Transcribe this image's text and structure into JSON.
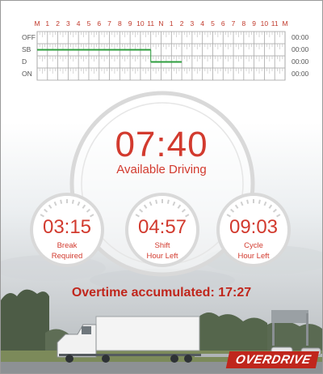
{
  "log_grid": {
    "hour_labels": [
      "M",
      "1",
      "2",
      "3",
      "4",
      "5",
      "6",
      "7",
      "8",
      "9",
      "10",
      "11",
      "N",
      "1",
      "2",
      "3",
      "4",
      "5",
      "6",
      "7",
      "8",
      "9",
      "10",
      "11",
      "M"
    ],
    "rows": [
      {
        "status": "OFF",
        "total": "00:00"
      },
      {
        "status": "SB",
        "total": "00:00"
      },
      {
        "status": "D",
        "total": "00:00"
      },
      {
        "status": "ON",
        "total": "00:00"
      }
    ],
    "line_color": "#2e9e3e"
  },
  "main_dial": {
    "time": "07:40",
    "label": "Available Driving"
  },
  "small_dials": [
    {
      "time": "03:15",
      "label_line1": "Break",
      "label_line2": "Required"
    },
    {
      "time": "04:57",
      "label_line1": "Shift",
      "label_line2": "Hour Left"
    },
    {
      "time": "09:03",
      "label_line1": "Cycle",
      "label_line2": "Hour Left"
    }
  ],
  "overtime_text": "Overtime accumulated: 17:27",
  "brand": "OVERDRIVE",
  "colors": {
    "accent": "#d23a2e",
    "dial_ring": "#d9d9d9"
  }
}
